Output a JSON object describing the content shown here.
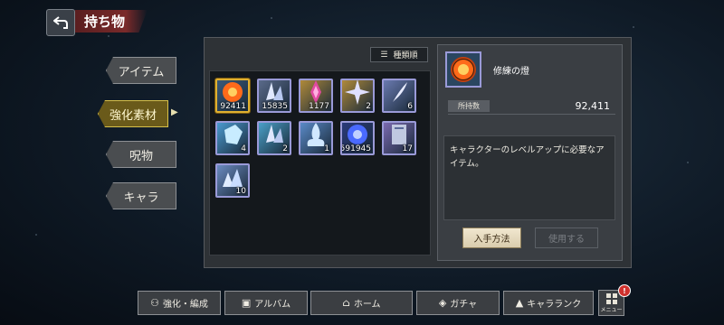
{
  "header": {
    "title": "持ち物",
    "back_icon": "back-arrow-icon"
  },
  "tabs": [
    {
      "label": "アイテム",
      "active": false
    },
    {
      "label": "強化素材",
      "active": true
    },
    {
      "label": "呪物",
      "active": false
    },
    {
      "label": "キャラ",
      "active": false
    }
  ],
  "sort_button": {
    "label": "種類順",
    "icon": "sort-icon"
  },
  "items": [
    {
      "count": "92411",
      "selected": true,
      "icon": "flame-orb-icon",
      "bg": "#3a5a7a",
      "accent": "#ff6a1a"
    },
    {
      "count": "15835",
      "selected": false,
      "icon": "crystal-shards-icon",
      "bg": "#5a6a8a",
      "accent": "#b0c0e0"
    },
    {
      "count": "1177",
      "selected": false,
      "icon": "magenta-crystal-icon",
      "bg": "#b08a3a",
      "accent": "#e04aa0"
    },
    {
      "count": "2",
      "selected": false,
      "icon": "crystal-burst-icon",
      "bg": "#b08a3a",
      "accent": "#d0d0f0"
    },
    {
      "count": "6",
      "selected": false,
      "icon": "feather-icon",
      "bg": "#6a7ab0",
      "accent": "#d0d8f0"
    },
    {
      "count": "4",
      "selected": false,
      "icon": "crystal-block-icon",
      "bg": "#4a9ad0",
      "accent": "#d0f0ff"
    },
    {
      "count": "2",
      "selected": false,
      "icon": "crystal-shards-icon",
      "bg": "#4aa0c8",
      "accent": "#e0f0ff"
    },
    {
      "count": "1",
      "selected": false,
      "icon": "blue-flame-icon",
      "bg": "#5a8ac8",
      "accent": "#d0e8ff"
    },
    {
      "count": "591945",
      "selected": false,
      "icon": "blue-orb-icon",
      "bg": "#2a3a7a",
      "accent": "#4a6aff"
    },
    {
      "count": "17",
      "selected": false,
      "icon": "scroll-stack-icon",
      "bg": "#7a6ab0",
      "accent": "#c0c8e0"
    },
    {
      "count": "10",
      "selected": false,
      "icon": "crystal-pile-icon",
      "bg": "#6a8ac0",
      "accent": "#d0e0f0"
    }
  ],
  "detail": {
    "name": "修練の燈",
    "stock_label": "所持数",
    "stock_value": "92,411",
    "description": "キャラクターのレベルアップに必要なアイテム。",
    "obtain_button": "入手方法",
    "use_button": "使用する"
  },
  "bottom_nav": [
    {
      "label": "強化・編成",
      "icon": "party-icon"
    },
    {
      "label": "アルバム",
      "icon": "album-icon"
    },
    {
      "label": "ホーム",
      "icon": "home-icon"
    },
    {
      "label": "ガチャ",
      "icon": "gacha-icon"
    },
    {
      "label": "キャラランク",
      "icon": "rank-icon"
    }
  ],
  "menu": {
    "label": "メニュー",
    "badge": "!"
  }
}
